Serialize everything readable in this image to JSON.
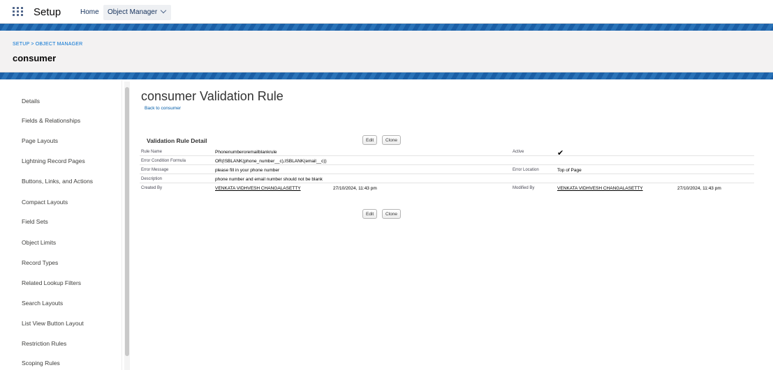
{
  "topnav": {
    "app_title": "Setup",
    "tabs": [
      {
        "label": "Home"
      },
      {
        "label": "Object Manager"
      }
    ]
  },
  "header": {
    "breadcrumb": "SETUP > OBJECT MANAGER",
    "object_title": "consumer"
  },
  "sidebar": {
    "items": [
      {
        "label": "Details"
      },
      {
        "label": "Fields & Relationships"
      },
      {
        "label": "Page Layouts"
      },
      {
        "label": "Lightning Record Pages"
      },
      {
        "label": "Buttons, Links, and Actions"
      },
      {
        "label": "Compact Layouts"
      },
      {
        "label": "Field Sets"
      },
      {
        "label": "Object Limits"
      },
      {
        "label": "Record Types"
      },
      {
        "label": "Related Lookup Filters"
      },
      {
        "label": "Search Layouts"
      },
      {
        "label": "List View Button Layout"
      },
      {
        "label": "Restriction Rules"
      },
      {
        "label": "Scoping Rules"
      }
    ]
  },
  "main": {
    "title": "consumer Validation Rule",
    "back_link": "Back to consumer",
    "section_title": "Validation Rule Detail",
    "edit_label": "Edit",
    "clone_label": "Clone",
    "fields": {
      "rule_name_label": "Rule Name",
      "rule_name_value": "Phonenumberoremailblankrule",
      "active_label": "Active",
      "active_value": "✔",
      "error_condition_label": "Error Condition Formula",
      "error_condition_value": "OR(ISBLANK(phone_number__c),ISBLANK(email__c))",
      "error_message_label": "Error Message",
      "error_message_value": "please fill in your phone number",
      "error_location_label": "Error Location",
      "error_location_value": "Top of Page",
      "description_label": "Description",
      "description_value": "phone number and email number should not be blank",
      "created_by_label": "Created By",
      "created_by_user": "VENKATA VIDHVESH CHANGALASETTY",
      "created_by_date": "27/10/2024, 11:43 pm",
      "modified_by_label": "Modified By",
      "modified_by_user": "VENKATA VIDHVESH CHANGALASETTY",
      "modified_by_date": "27/10/2024, 11:43 pm"
    }
  }
}
